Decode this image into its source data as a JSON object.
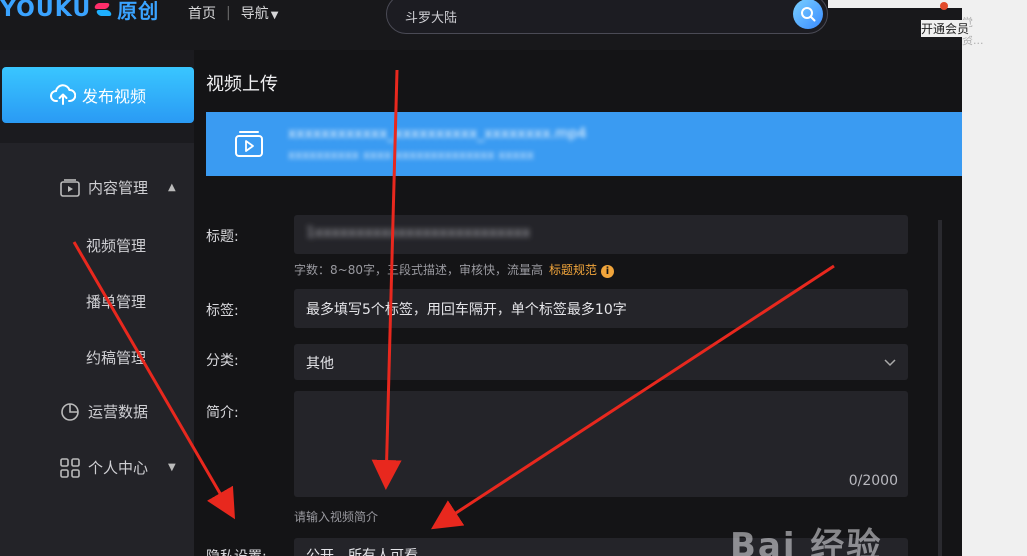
{
  "header": {
    "logo_text": "YOUKU",
    "logo_cn": "原创",
    "nav_home": "首页",
    "nav_separator": "|",
    "nav_guide": "导航",
    "search_value": "斗罗大陆",
    "vip_link": "开通会员",
    "faint_text_1": "觉",
    "faint_text_2": "资..."
  },
  "sidebar": {
    "publish_button": "发布视频",
    "content_manage": "内容管理",
    "video_manage": "视频管理",
    "playlist_manage": "播单管理",
    "commission_manage": "约稿管理",
    "operation_data": "运营数据",
    "personal_center": "个人中心"
  },
  "main": {
    "page_title": "视频上传",
    "file_name": "xxxxxxxxxxxx_xxxxxxxxxx_xxxxxxxx.mp4",
    "file_meta": "xxxxxxxxxx  xxxx  xxxxxxxxxxxxxx  xxxxx",
    "title_label": "标题:",
    "title_value": "1xxxxxxxxxxxxxxxxxxxxxxxxxx",
    "title_hint": "字数：8~80字，三段式描述，审核快，流量高",
    "title_rule_link": "标题规范",
    "tags_label": "标签:",
    "tags_placeholder": "最多填写5个标签，用回车隔开，单个标签最多10字",
    "category_label": "分类:",
    "category_value": "其他",
    "intro_label": "简介:",
    "intro_counter": "0/2000",
    "intro_hint": "请输入视频简介",
    "privacy_label": "隐私设置:",
    "privacy_value": "公开，所有人可看"
  },
  "watermark": "Bai 经验",
  "colors": {
    "accent_blue": "#3a9bf2",
    "publish_button": "#2fb2fb",
    "link_orange": "#f1a53b",
    "arrow_red": "#e8281e"
  }
}
